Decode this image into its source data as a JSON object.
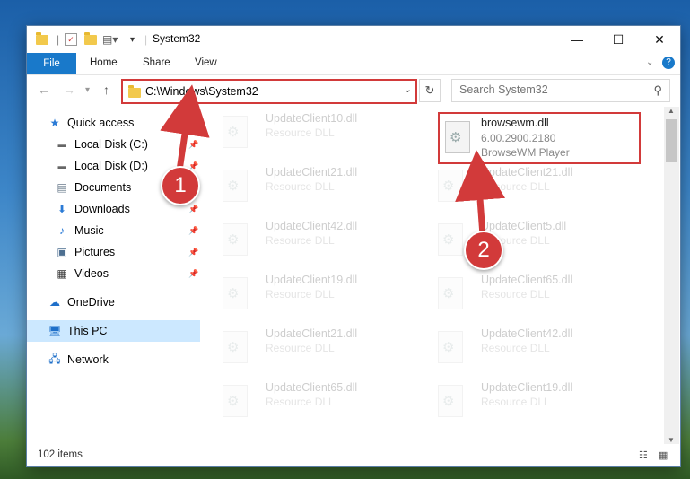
{
  "window": {
    "title": "System32",
    "controls": {
      "minimize": "—",
      "maximize": "☐",
      "close": "✕"
    }
  },
  "ribbon": {
    "file": "File",
    "tabs": [
      "Home",
      "Share",
      "View"
    ]
  },
  "address": {
    "path": "C:\\Windows\\System32",
    "search_placeholder": "Search System32"
  },
  "sidebar": {
    "items": [
      {
        "label": "Quick access",
        "icon": "star-icon",
        "pinned": false
      },
      {
        "label": "Local Disk (C:)",
        "icon": "drive-icon",
        "pinned": true
      },
      {
        "label": "Local Disk (D:)",
        "icon": "drive-icon",
        "pinned": true
      },
      {
        "label": "Documents",
        "icon": "documents-icon",
        "pinned": true
      },
      {
        "label": "Downloads",
        "icon": "download-icon",
        "pinned": true
      },
      {
        "label": "Music",
        "icon": "music-icon",
        "pinned": true
      },
      {
        "label": "Pictures",
        "icon": "pictures-icon",
        "pinned": true
      },
      {
        "label": "Videos",
        "icon": "videos-icon",
        "pinned": true
      },
      {
        "label": "OneDrive",
        "icon": "cloud-icon",
        "pinned": false
      },
      {
        "label": "This PC",
        "icon": "computer-icon",
        "pinned": false,
        "selected": true
      },
      {
        "label": "Network",
        "icon": "network-icon",
        "pinned": false
      }
    ]
  },
  "files": {
    "left_column": [
      {
        "name": "UpdateClient10.dll",
        "type": "Resource DLL"
      },
      {
        "name": "UpdateClient21.dll",
        "type": "Resource DLL"
      },
      {
        "name": "UpdateClient42.dll",
        "type": "Resource DLL"
      },
      {
        "name": "UpdateClient19.dll",
        "type": "Resource DLL"
      },
      {
        "name": "UpdateClient21.dll",
        "type": "Resource DLL"
      },
      {
        "name": "UpdateClient65.dll",
        "type": "Resource DLL"
      }
    ],
    "right_column": [
      {
        "name": "browsewm.dll",
        "version": "6.00.2900.2180",
        "type": "BrowseWM Player"
      },
      {
        "name": "UpdateClient21.dll",
        "type": "Resource DLL"
      },
      {
        "name": "UpdateClient5.dll",
        "type": "Resource DLL"
      },
      {
        "name": "UpdateClient65.dll",
        "type": "Resource DLL"
      },
      {
        "name": "UpdateClient42.dll",
        "type": "Resource DLL"
      },
      {
        "name": "UpdateClient19.dll",
        "type": "Resource DLL"
      }
    ]
  },
  "status": {
    "items_count": "102 items"
  },
  "annotations": {
    "marker1": "1",
    "marker2": "2",
    "color": "#d23a3a"
  }
}
